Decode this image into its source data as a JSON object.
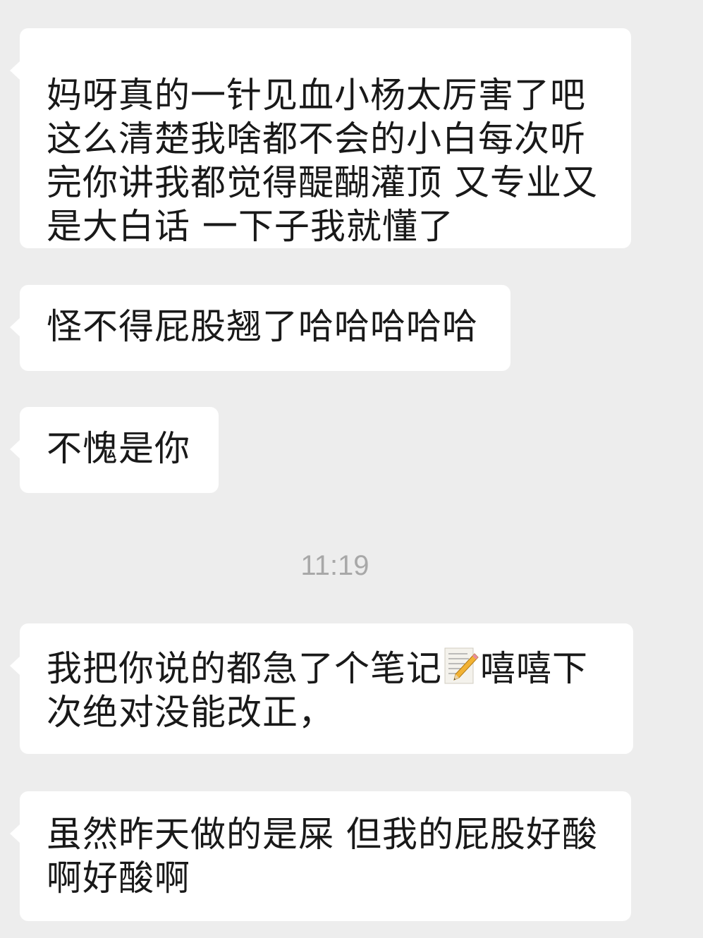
{
  "chat": {
    "messages": [
      {
        "text": "妈呀真的一针见血小杨太厉害了吧\n这么清楚我啥都不会的小白每次听\n完你讲我都觉得醍醐灌顶 又专业又\n是大白话 一下子我就懂了"
      },
      {
        "text": "怪不得屁股翘了哈哈哈哈哈"
      },
      {
        "text": "不愧是你"
      },
      {
        "text_before": "我把你说的都急了个笔记",
        "emoji": "memo-pencil-emoji",
        "text_after": "嘻嘻下\n次绝对没能改正，"
      },
      {
        "text": "虽然昨天做的是屎 但我的屁股好酸\n啊好酸啊"
      }
    ],
    "timestamp": "11:19"
  },
  "colors": {
    "background": "#ededed",
    "bubble": "#ffffff",
    "text": "#191919",
    "timestamp": "#a8a8a8"
  }
}
